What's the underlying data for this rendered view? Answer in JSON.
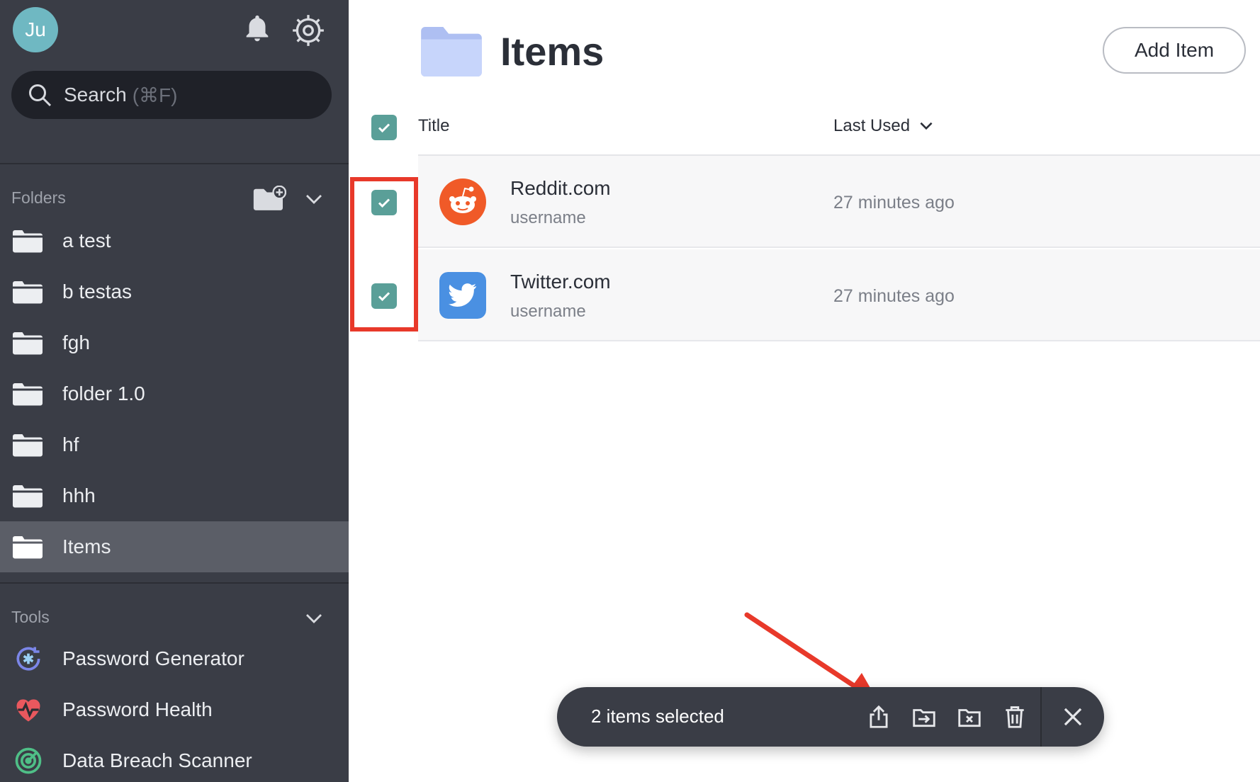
{
  "user": {
    "initials": "Ju",
    "avatar_color": "#6fb8c2"
  },
  "search": {
    "label": "Search",
    "shortcut": "(⌘F)"
  },
  "sidebar": {
    "folders_label": "Folders",
    "folders": [
      {
        "label": "a test"
      },
      {
        "label": "b testas"
      },
      {
        "label": "fgh"
      },
      {
        "label": "folder 1.0"
      },
      {
        "label": "hf"
      },
      {
        "label": "hhh"
      },
      {
        "label": "Items"
      }
    ],
    "active_folder": "Items",
    "tools_label": "Tools",
    "tools": [
      {
        "label": "Password Generator",
        "icon": "password-generator-icon"
      },
      {
        "label": "Password Health",
        "icon": "heart-pulse-icon"
      },
      {
        "label": "Data Breach Scanner",
        "icon": "radar-icon"
      }
    ]
  },
  "main": {
    "title": "Items",
    "add_button": "Add Item",
    "columns": {
      "title": "Title",
      "last_used": "Last Used"
    },
    "items": [
      {
        "name": "Reddit.com",
        "username": "username",
        "last_used": "27 minutes ago",
        "icon": "reddit-icon",
        "checked": true
      },
      {
        "name": "Twitter.com",
        "username": "username",
        "last_used": "27 minutes ago",
        "icon": "twitter-icon",
        "checked": true
      }
    ]
  },
  "bulk_bar": {
    "label": "2 items selected",
    "actions": [
      "share-icon",
      "move-icon",
      "remove-from-folder-icon",
      "trash-icon",
      "close-icon"
    ]
  },
  "colors": {
    "sidebar_bg": "#3a3d46",
    "accent_checkbox": "#5a9f98",
    "highlight": "#e8392a",
    "reddit": "#f05a28",
    "twitter": "#4a90e2"
  }
}
